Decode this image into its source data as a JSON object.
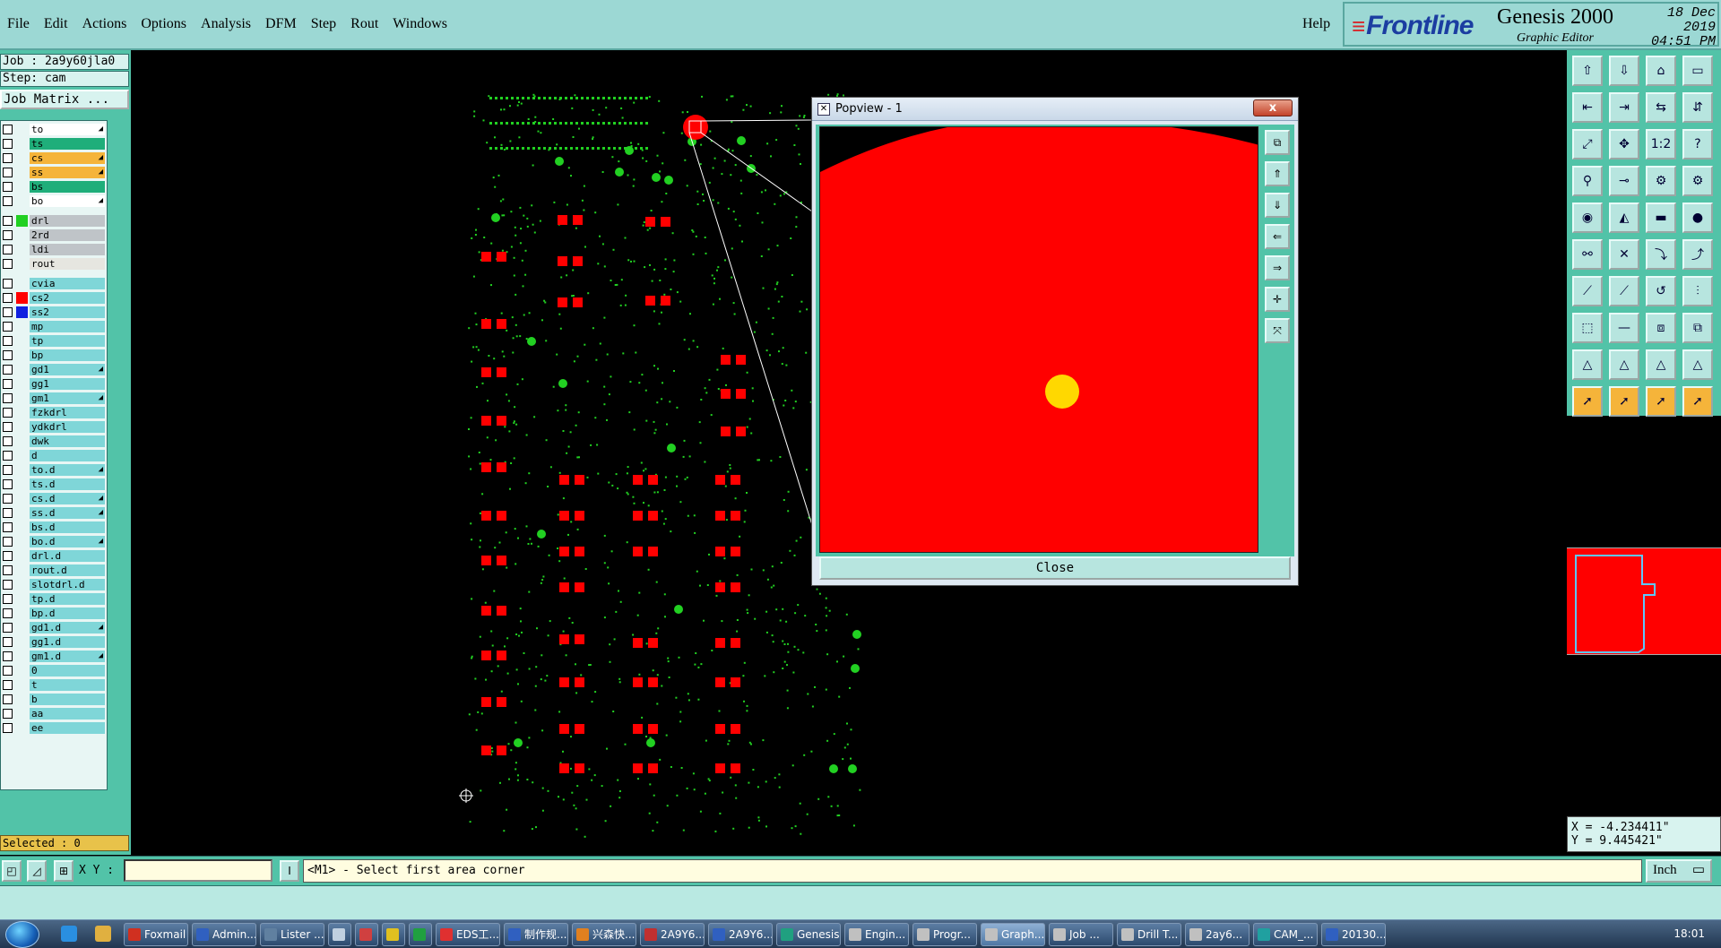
{
  "menubar": {
    "items": [
      {
        "label": "File",
        "name": "menu-file"
      },
      {
        "label": "Edit",
        "name": "menu-edit"
      },
      {
        "label": "Actions",
        "name": "menu-actions"
      },
      {
        "label": "Options",
        "name": "menu-options"
      },
      {
        "label": "Analysis",
        "name": "menu-analysis"
      },
      {
        "label": "DFM",
        "name": "menu-dfm"
      },
      {
        "label": "Step",
        "name": "menu-step"
      },
      {
        "label": "Rout",
        "name": "menu-rout"
      },
      {
        "label": "Windows",
        "name": "menu-windows"
      }
    ],
    "help": "Help"
  },
  "brand": {
    "logo": "Frontline",
    "product": "Genesis 2000",
    "subtitle": "Graphic Editor",
    "date": "18 Dec 2019",
    "time": "04:51 PM"
  },
  "leftpanel": {
    "job": "Job : 2a9y60jla0",
    "step": "Step: cam",
    "job_matrix": "Job Matrix ...",
    "selected": "Selected : 0",
    "layers": [
      {
        "name": "to",
        "color": "#ffffff",
        "arrow": true
      },
      {
        "name": "ts",
        "color": "#1fae7a",
        "arrow": false
      },
      {
        "name": "cs",
        "color": "#f5b43a",
        "arrow": true
      },
      {
        "name": "ss",
        "color": "#f5b43a",
        "arrow": true
      },
      {
        "name": "bs",
        "color": "#1fae7a",
        "arrow": false
      },
      {
        "name": "bo",
        "color": "#ffffff",
        "arrow": true
      },
      {
        "name": "drl",
        "color": "#bfc4c8",
        "arrow": false,
        "swatch": "#22d022"
      },
      {
        "name": "2rd",
        "color": "#bfc4c8",
        "arrow": false
      },
      {
        "name": "ldi",
        "color": "#bfc4c8",
        "arrow": false
      },
      {
        "name": "rout",
        "color": "#e6e6e0",
        "arrow": false
      },
      {
        "name": "cvia",
        "color": "#7fd6d8",
        "arrow": false
      },
      {
        "name": "cs2",
        "color": "#7fd6d8",
        "arrow": false,
        "swatch": "#ff0000",
        "dot": true
      },
      {
        "name": "ss2",
        "color": "#7fd6d8",
        "arrow": false,
        "swatch": "#1020e0"
      },
      {
        "name": "mp",
        "color": "#7fd6d8",
        "arrow": false
      },
      {
        "name": "tp",
        "color": "#7fd6d8",
        "arrow": false
      },
      {
        "name": "bp",
        "color": "#7fd6d8",
        "arrow": false
      },
      {
        "name": "gd1",
        "color": "#7fd6d8",
        "arrow": true
      },
      {
        "name": "gg1",
        "color": "#7fd6d8",
        "arrow": false
      },
      {
        "name": "gm1",
        "color": "#7fd6d8",
        "arrow": true
      },
      {
        "name": "fzkdrl",
        "color": "#7fd6d8",
        "arrow": false
      },
      {
        "name": "ydkdrl",
        "color": "#7fd6d8",
        "arrow": false
      },
      {
        "name": "dwk",
        "color": "#7fd6d8",
        "arrow": false
      },
      {
        "name": "d",
        "color": "#7fd6d8",
        "arrow": false
      },
      {
        "name": "to.d",
        "color": "#7fd6d8",
        "arrow": true
      },
      {
        "name": "ts.d",
        "color": "#7fd6d8",
        "arrow": false
      },
      {
        "name": "cs.d",
        "color": "#7fd6d8",
        "arrow": true
      },
      {
        "name": "ss.d",
        "color": "#7fd6d8",
        "arrow": true
      },
      {
        "name": "bs.d",
        "color": "#7fd6d8",
        "arrow": false
      },
      {
        "name": "bo.d",
        "color": "#7fd6d8",
        "arrow": true
      },
      {
        "name": "drl.d",
        "color": "#7fd6d8",
        "arrow": false
      },
      {
        "name": "rout.d",
        "color": "#7fd6d8",
        "arrow": false
      },
      {
        "name": "slotdrl.d",
        "color": "#7fd6d8",
        "arrow": false
      },
      {
        "name": "tp.d",
        "color": "#7fd6d8",
        "arrow": false
      },
      {
        "name": "bp.d",
        "color": "#7fd6d8",
        "arrow": false
      },
      {
        "name": "gd1.d",
        "color": "#7fd6d8",
        "arrow": true
      },
      {
        "name": "gg1.d",
        "color": "#7fd6d8",
        "arrow": false
      },
      {
        "name": "gm1.d",
        "color": "#7fd6d8",
        "arrow": true
      },
      {
        "name": "0",
        "color": "#7fd6d8",
        "arrow": false
      },
      {
        "name": "t",
        "color": "#7fd6d8",
        "arrow": false
      },
      {
        "name": "b",
        "color": "#7fd6d8",
        "arrow": false
      },
      {
        "name": "aa",
        "color": "#7fd6d8",
        "arrow": false
      },
      {
        "name": "ee",
        "color": "#7fd6d8",
        "arrow": false
      }
    ]
  },
  "popview": {
    "title": "Popview - 1",
    "close_x": "x",
    "close_button": "Close"
  },
  "coords": {
    "x": "X = -4.234411\"",
    "y": "Y = 9.445421\""
  },
  "cmdbar": {
    "xy_label": "X Y :",
    "xy_value": "",
    "prompt": "<M1> - Select first area corner",
    "unit": "Inch"
  },
  "taskbar": {
    "tasks": [
      {
        "label": "Foxmail",
        "icon": "#d03020"
      },
      {
        "label": "Admin...",
        "icon": "#3060c0"
      },
      {
        "label": "Lister ...",
        "icon": "#6080a0"
      },
      {
        "label": "",
        "icon": "#c0d0e0"
      },
      {
        "label": "",
        "icon": "#d04040"
      },
      {
        "label": "",
        "icon": "#e0c020"
      },
      {
        "label": "",
        "icon": "#20a040"
      },
      {
        "label": "EDS工...",
        "icon": "#e03030"
      },
      {
        "label": "制作规...",
        "icon": "#3060c0"
      },
      {
        "label": "兴森快...",
        "icon": "#e08020"
      },
      {
        "label": "2A9Y6...",
        "icon": "#c03030"
      },
      {
        "label": "2A9Y6...",
        "icon": "#3060c0"
      },
      {
        "label": "Genesis",
        "icon": "#20a080"
      },
      {
        "label": "Engin...",
        "icon": "#c0c0c0"
      },
      {
        "label": "Progr...",
        "icon": "#c0c0c0"
      },
      {
        "label": "Graph...",
        "icon": "#c0c0c0",
        "active": true
      },
      {
        "label": "Job ...",
        "icon": "#c0c0c0"
      },
      {
        "label": "Drill T...",
        "icon": "#c0c0c0"
      },
      {
        "label": "2ay6...",
        "icon": "#c0c0c0"
      },
      {
        "label": "CAM_...",
        "icon": "#20a0a0"
      },
      {
        "label": "20130...",
        "icon": "#3060c0"
      }
    ],
    "clock": "18:01"
  },
  "colors": {
    "teal_bar": "#9cd8d4",
    "panel": "#52c3a8",
    "pad_green": "#22d022",
    "pad_red": "#ff0000",
    "drill_yellow": "#ffd800"
  }
}
